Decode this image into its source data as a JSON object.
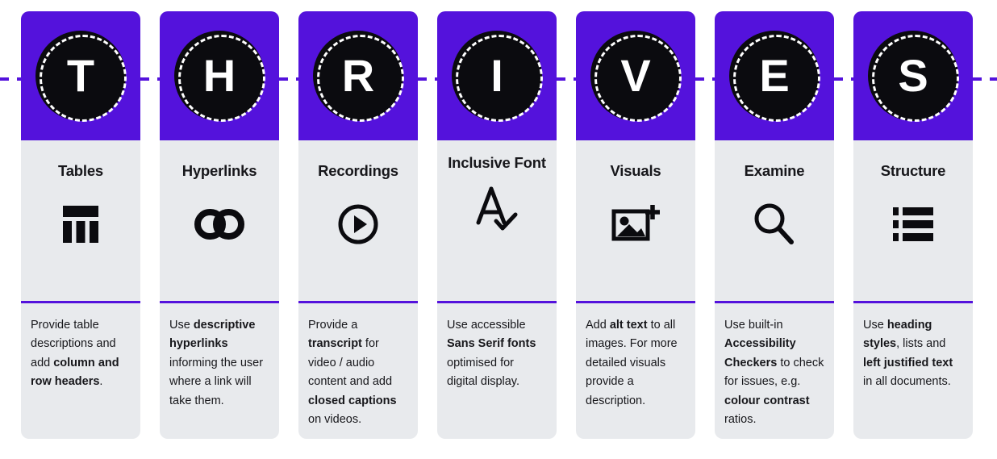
{
  "theme": {
    "purple": "#5412DC",
    "card_bg": "#E8EAED",
    "badge_bg": "#0B0B0F",
    "text": "#17171B",
    "page_bg": "#FFFFFF"
  },
  "acronym": "THRIVES",
  "connector": {
    "style": "dashed",
    "color": "#5412DC",
    "description": "dashed horizontal line linking the letter badges"
  },
  "cards": [
    {
      "letter": "T",
      "title": "Tables",
      "icon": "table-icon",
      "body_html": "Provide table descriptions and add <b>column and row headers</b>.",
      "body_text": "Provide table descriptions and add column and row headers."
    },
    {
      "letter": "H",
      "title": "Hyperlinks",
      "icon": "link-icon",
      "body_html": "Use <b>descriptive hyperlinks</b> informing the user where a link will take them.",
      "body_text": "Use descriptive hyperlinks informing the user where a link will take them."
    },
    {
      "letter": "R",
      "title": "Recordings",
      "icon": "play-circle-icon",
      "body_html": "Provide a <b>transcript</b> for video / audio content and add <b>closed captions</b> on videos.",
      "body_text": "Provide a transcript for video / audio content and add closed captions on videos."
    },
    {
      "letter": "I",
      "title": "Inclusive Font",
      "icon": "font-check-icon",
      "body_html": "Use accessible <b>Sans Serif fonts</b> optimised for digital display.",
      "body_text": "Use accessible Sans Serif fonts optimised for digital display."
    },
    {
      "letter": "V",
      "title": "Visuals",
      "icon": "image-plus-icon",
      "body_html": "Add <b>alt text</b> to all images. For more detailed visuals provide a description.",
      "body_text": "Add alt text to all images. For more detailed visuals provide a description."
    },
    {
      "letter": "E",
      "title": "Examine",
      "icon": "magnifier-icon",
      "body_html": "Use built-in <b>Accessibility Checkers</b> to check for issues, e.g. <b>colour contrast</b> ratios.",
      "body_text": "Use built-in Accessibility Checkers to check for issues, e.g. colour contrast ratios."
    },
    {
      "letter": "S",
      "title": "Structure",
      "icon": "bullet-list-icon",
      "body_html": "Use <b>heading styles</b>, lists and <b>left justified text</b> in all documents.",
      "body_text": "Use heading styles, lists and left justified text in all documents."
    }
  ]
}
